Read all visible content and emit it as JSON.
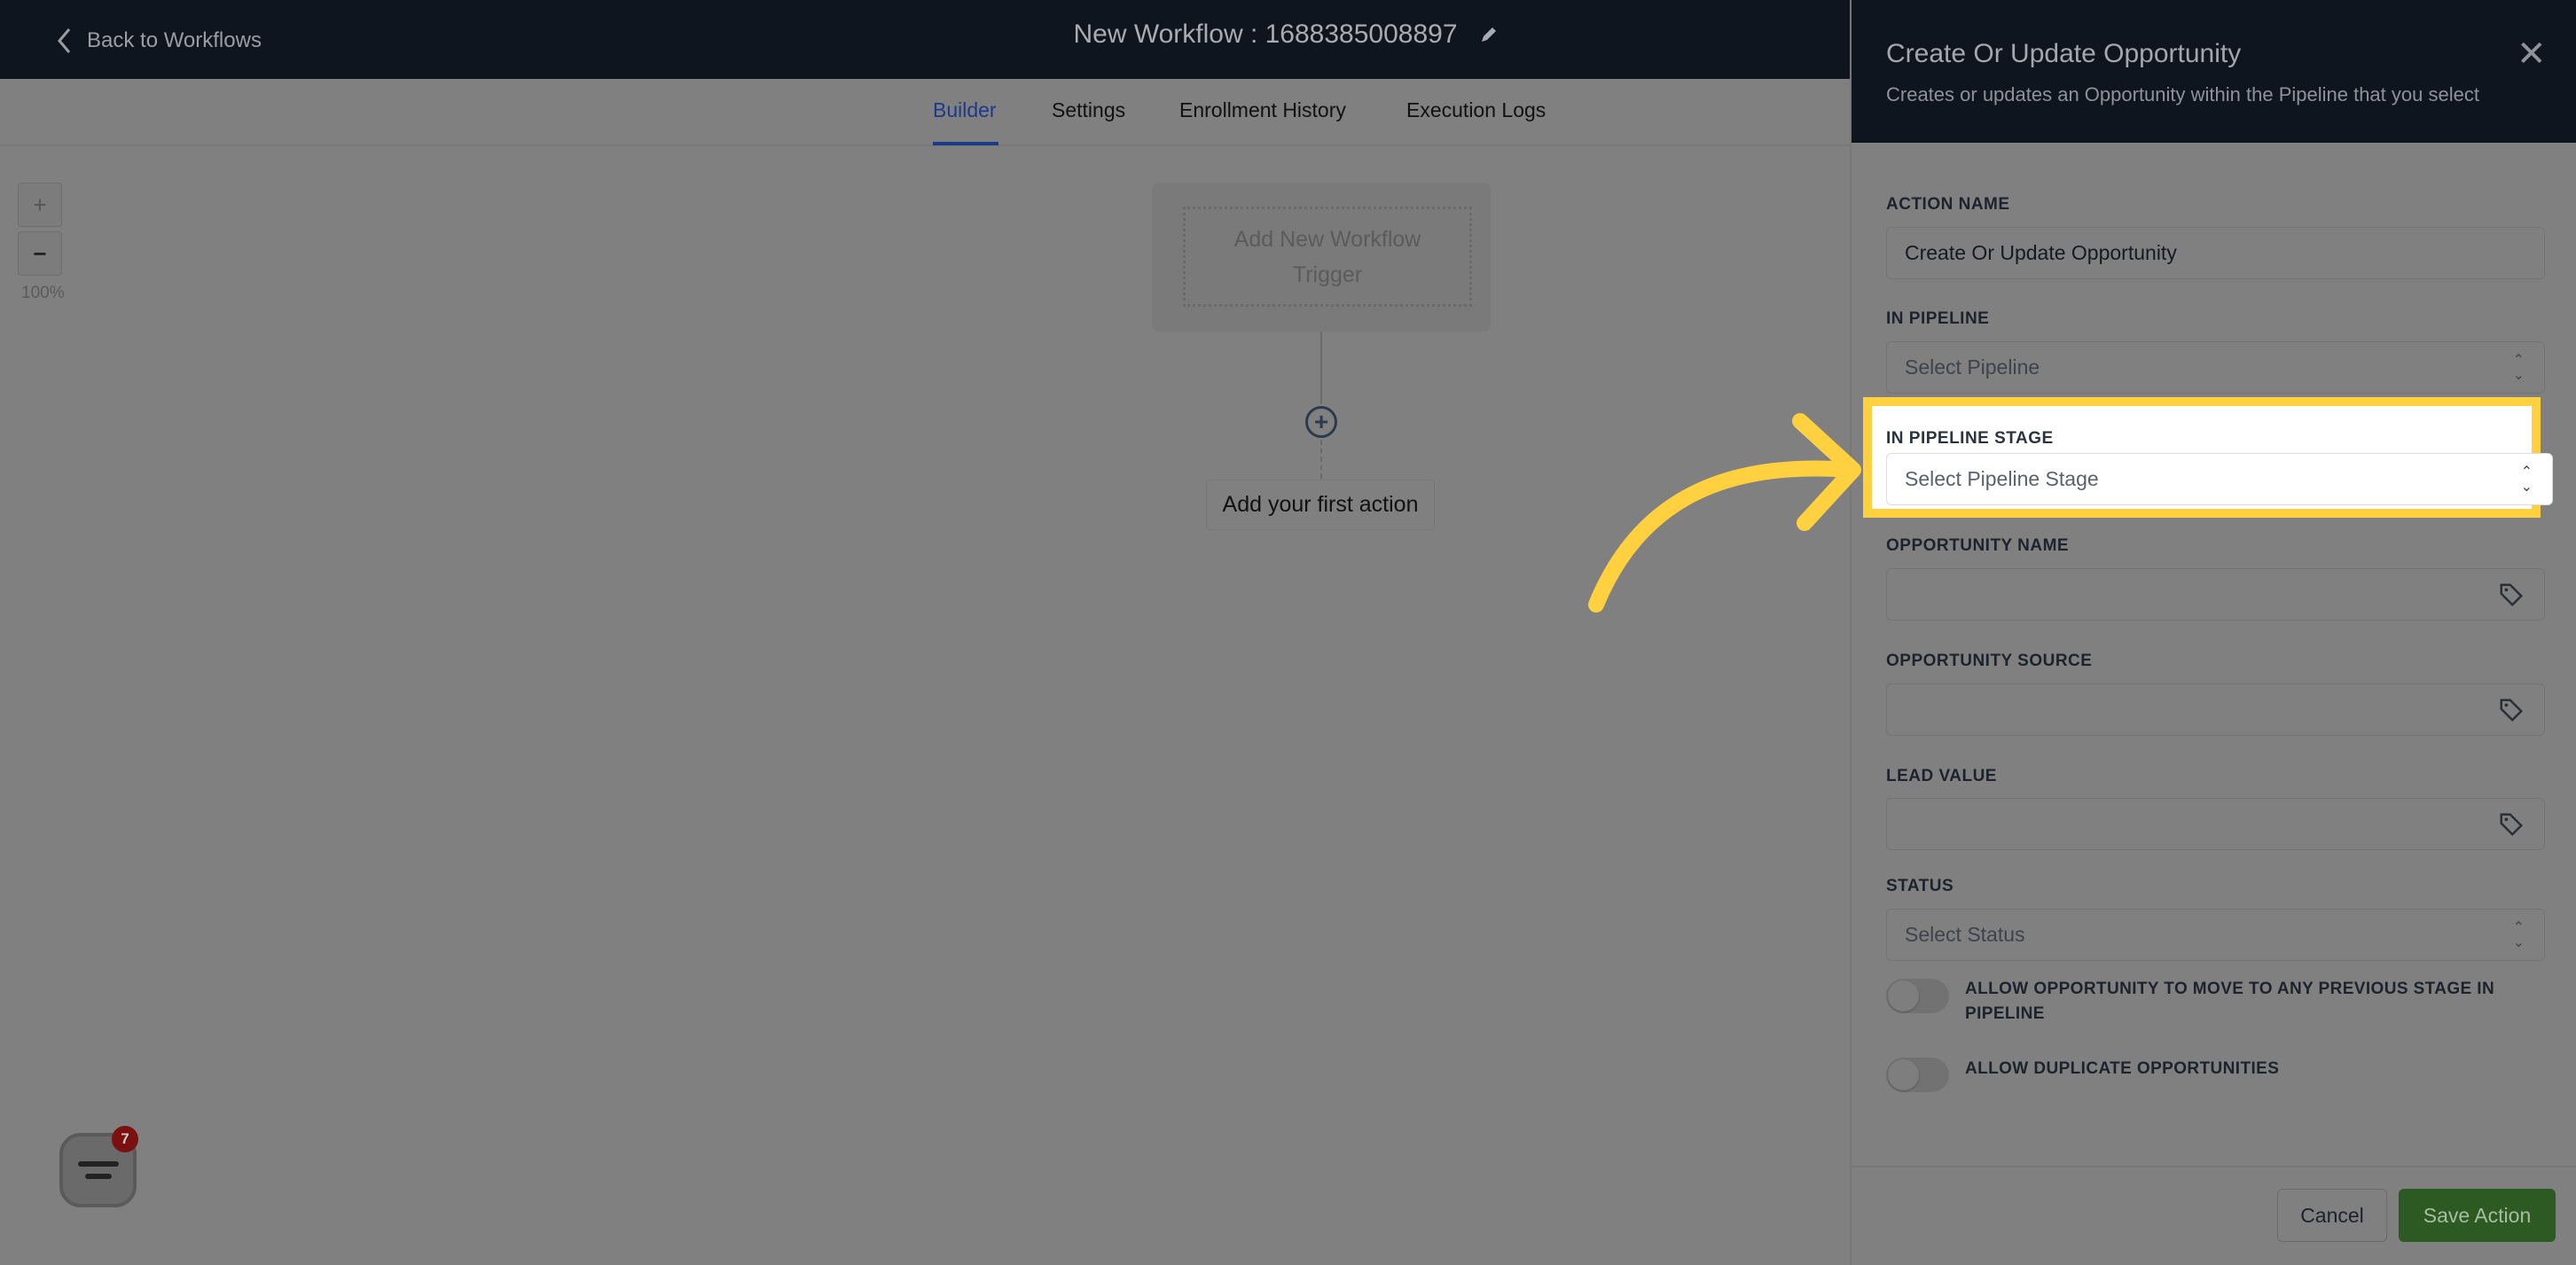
{
  "header": {
    "back_label": "Back to Workflows",
    "workflow_title": "New Workflow : 1688385008897"
  },
  "tabs": [
    {
      "label": "Builder",
      "active": true
    },
    {
      "label": "Settings"
    },
    {
      "label": "Enrollment History"
    },
    {
      "label": "Execution Logs"
    }
  ],
  "canvas": {
    "zoom_in": "+",
    "zoom_out": "−",
    "zoom_level": "100%",
    "trigger_label": "Add New Workflow Trigger",
    "first_action_label": "Add your first action"
  },
  "chat": {
    "badge_count": "7"
  },
  "panel": {
    "title": "Create Or Update Opportunity",
    "subtitle": "Creates or updates an Opportunity within the Pipeline that you select",
    "fields": {
      "action_name": {
        "label": "ACTION NAME",
        "value": "Create Or Update Opportunity"
      },
      "pipeline": {
        "label": "IN PIPELINE",
        "placeholder": "Select Pipeline"
      },
      "pipeline_stage": {
        "label": "IN PIPELINE STAGE",
        "placeholder": "Select Pipeline Stage"
      },
      "opportunity_name": {
        "label": "OPPORTUNITY NAME",
        "value": ""
      },
      "opportunity_source": {
        "label": "OPPORTUNITY SOURCE",
        "value": ""
      },
      "lead_value": {
        "label": "LEAD VALUE",
        "value": ""
      },
      "status": {
        "label": "STATUS",
        "placeholder": "Select Status"
      }
    },
    "toggles": [
      {
        "label": "ALLOW OPPORTUNITY TO MOVE TO ANY PREVIOUS STAGE IN PIPELINE",
        "on": false
      },
      {
        "label": "ALLOW DUPLICATE OPPORTUNITIES",
        "on": false
      }
    ],
    "cancel_label": "Cancel",
    "save_label": "Save Action"
  },
  "colors": {
    "highlight": "#ffd03f",
    "save": "#2d5a23",
    "active_tab": "#1b3a8c"
  }
}
